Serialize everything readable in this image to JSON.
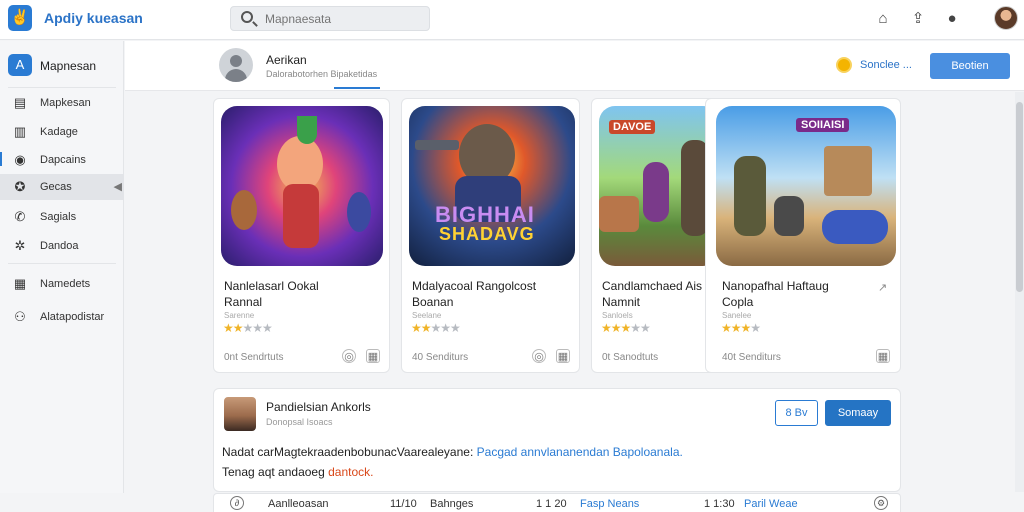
{
  "app": {
    "title": "Apdiy kueasan",
    "logo_glyph": "✌"
  },
  "search": {
    "placeholder": "Mapnaesata"
  },
  "topbar": {
    "icons": [
      "home-icon",
      "share-icon",
      "notification-icon",
      "avatar"
    ]
  },
  "sidebar": {
    "header": {
      "label": "Mapnesan",
      "icon": "app-icon"
    },
    "items": [
      {
        "label": "Mapkesan",
        "icon": "list-icon"
      },
      {
        "label": "Kadage",
        "icon": "stats-icon"
      },
      {
        "label": "Dapcains",
        "icon": "circle-icon"
      },
      {
        "label": "Gecas",
        "icon": "gamepad-icon",
        "active": true
      },
      {
        "label": "Sagials",
        "icon": "phone-icon"
      },
      {
        "label": "Dandoa",
        "icon": "gear-icon"
      },
      {
        "label": "Namedets",
        "icon": "grid-icon"
      },
      {
        "label": "Alatapodistar",
        "icon": "people-icon"
      }
    ]
  },
  "profile": {
    "name": "Aerikan",
    "subtitle": "Dalorabotorhen Bipaketidas"
  },
  "header_actions": {
    "coin_label": "Sonclee ...",
    "button_label": "Beotien"
  },
  "games": [
    {
      "title": "Nanlelasarl Ookal",
      "subtitle": "Rannal",
      "meta": "Sarenne",
      "rating": 2.5,
      "count": "0nt Sendrtuts"
    },
    {
      "title": "Mdalyacoal Rangolcost",
      "subtitle": "Boanan",
      "meta": "Seelane",
      "rating": 2.5,
      "count": "40 Senditurs",
      "art_text": [
        "BIGHHAI",
        "SHADAVG"
      ]
    },
    {
      "title": "Candlamchaed Ais",
      "subtitle": "Namnit",
      "meta": "Sanloels",
      "rating": 3.5,
      "count": "0t Sanodtuts",
      "art_text": [
        "DAVOE"
      ]
    },
    {
      "title": "Nanopafhal Haftaug",
      "subtitle": "Copla",
      "meta": "Sanelee",
      "rating": 3.5,
      "count": "40t Senditurs",
      "art_text": [
        "SOIIAISI"
      ]
    }
  ],
  "post": {
    "name": "Pandielsian Ankorls",
    "subtitle": "Donopsal Isoacs",
    "outline_button": "8 Bv",
    "button": "Somaay",
    "line1_text": "Nadat carMagtekraadenbobunacVaarealeyane:",
    "line1_link": "Pacgad annvlananendan Bapoloanala.",
    "line2_text": "Tenag aqt andaoeg",
    "line2_highlight": "dantock."
  },
  "bottom_row": {
    "col1": "Aanlleoasan",
    "col2": "11/10",
    "col3": "Bahnges",
    "col4": "1 1 20",
    "col5": "Fasp Neans",
    "col6": "1 1:30",
    "col7": "Paril Weae"
  },
  "colors": {
    "accent": "#2a7bd3",
    "star": "#f0b429",
    "highlight": "#d9481a"
  }
}
